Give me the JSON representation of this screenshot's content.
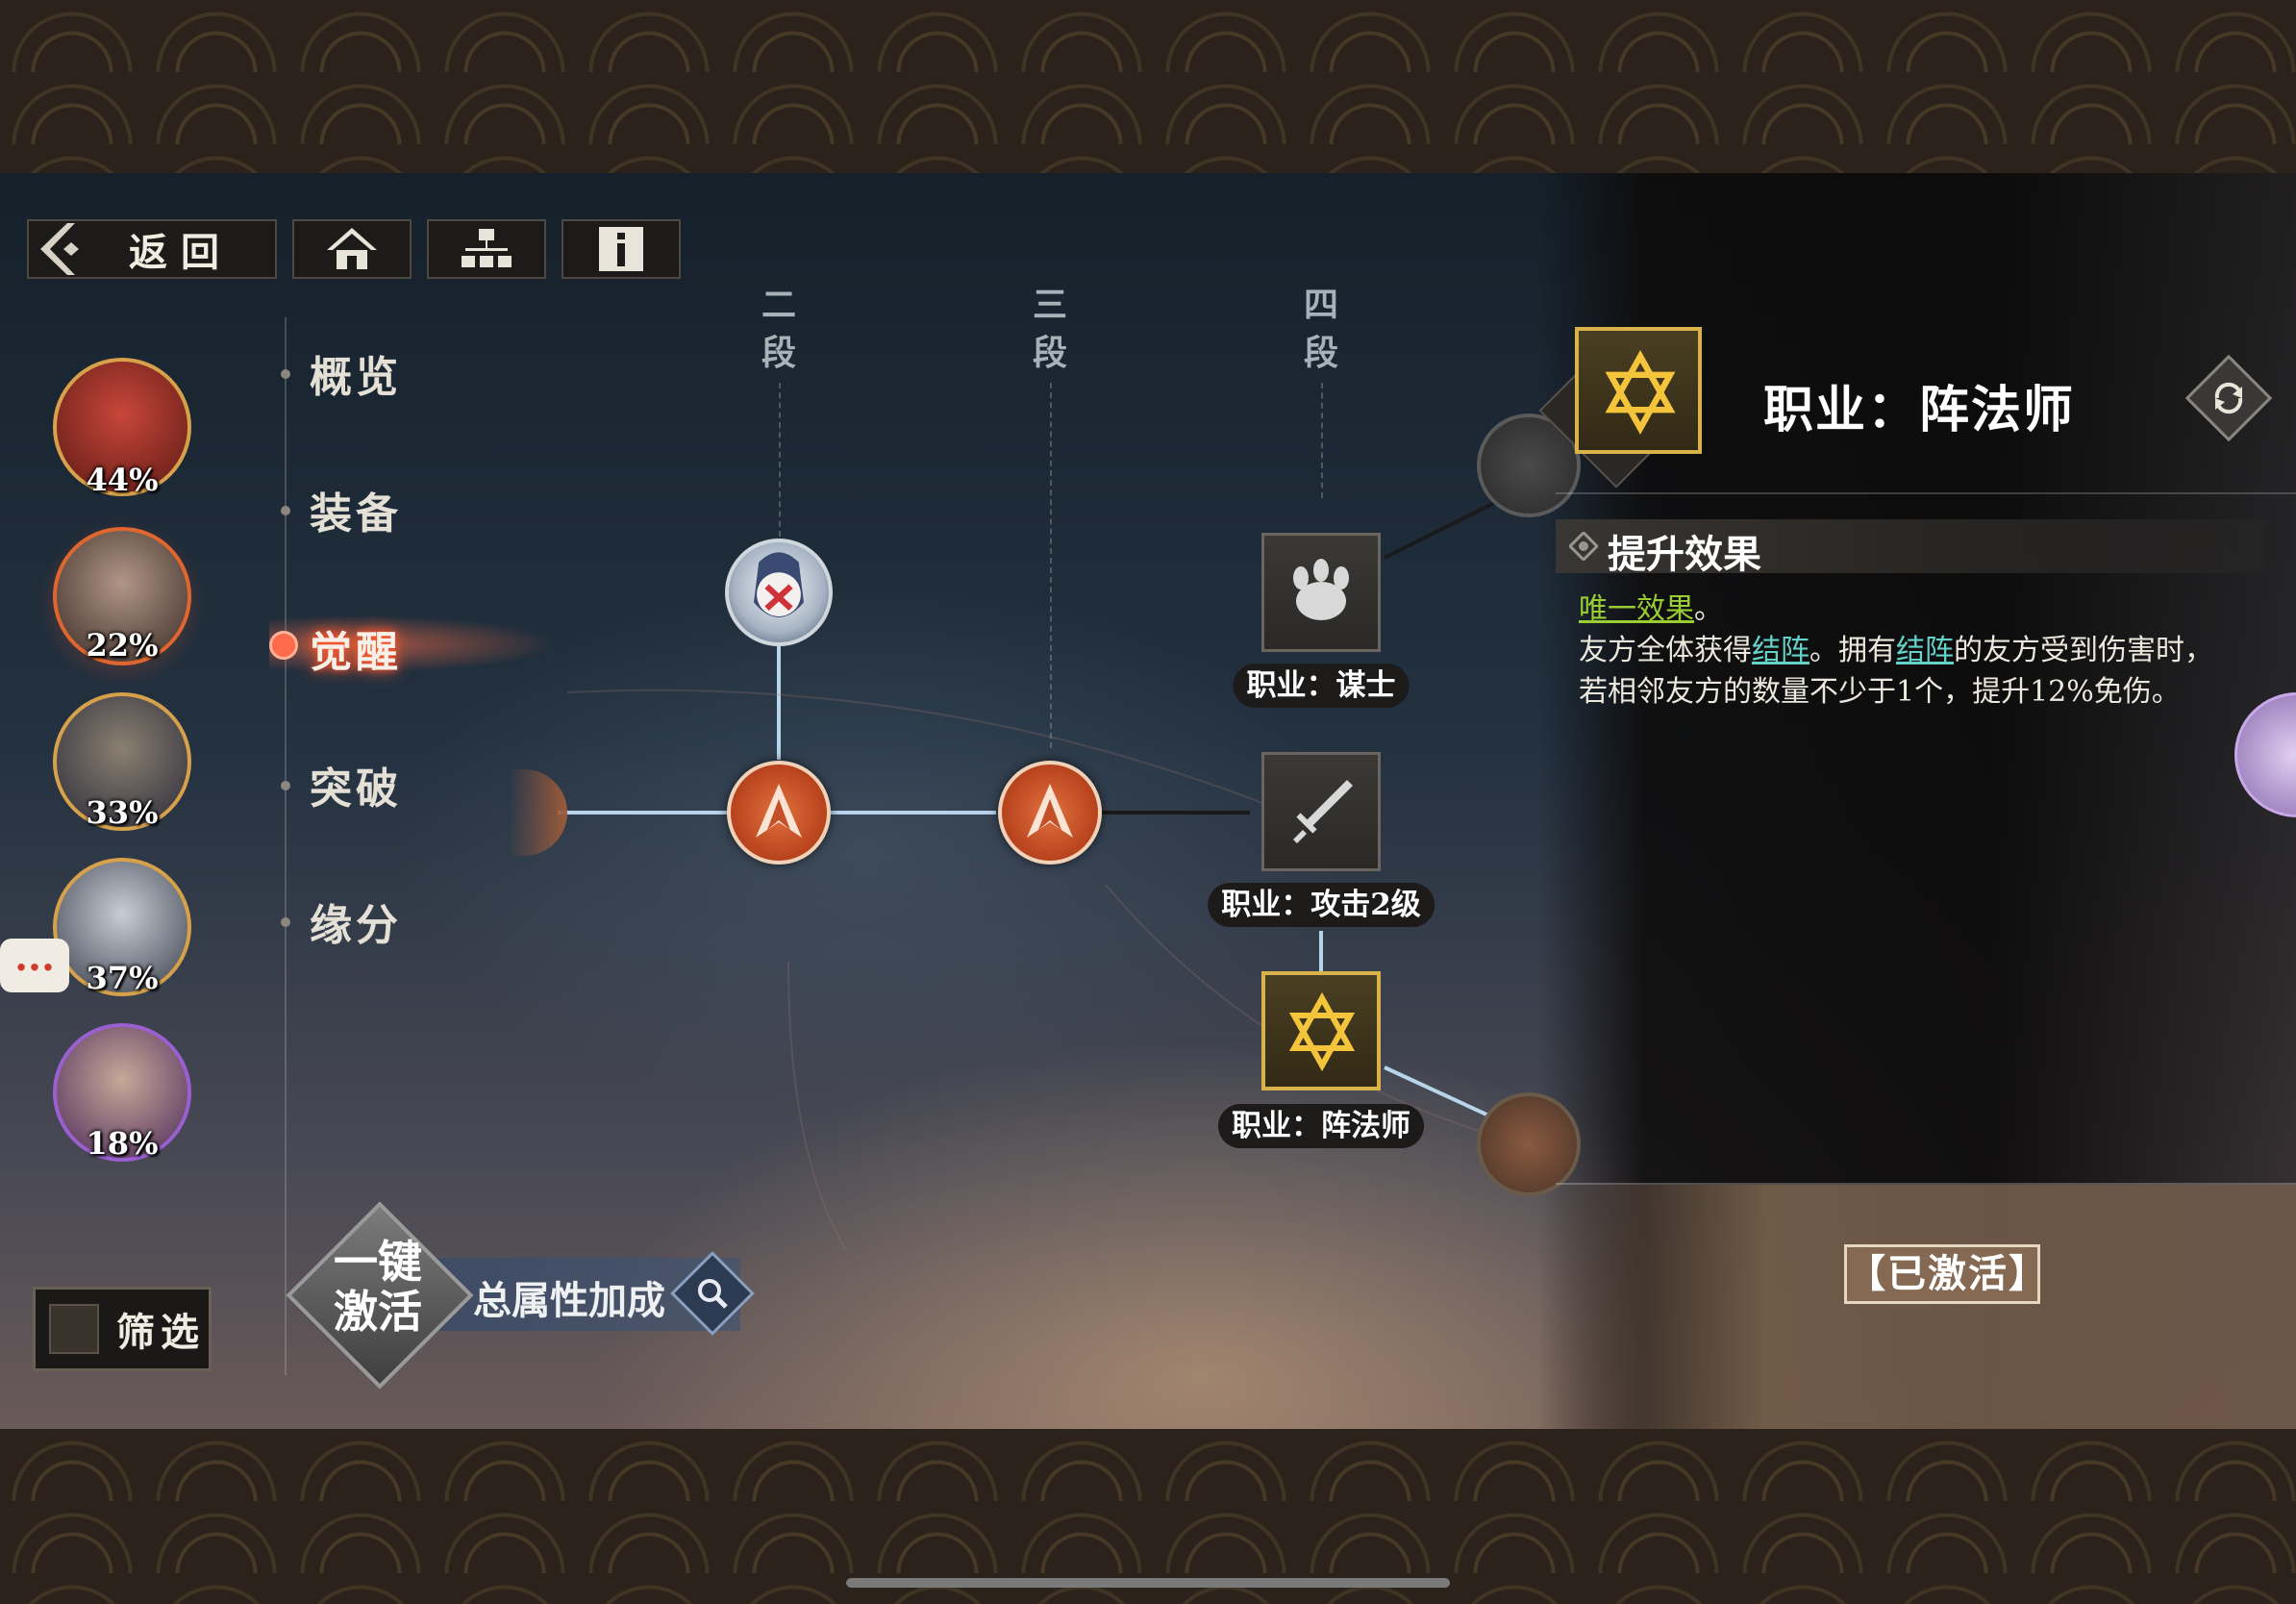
{
  "topbar": {
    "back_label": "返回",
    "buttons": [
      "home-icon",
      "tree-icon",
      "info-icon"
    ]
  },
  "heroes": [
    {
      "percent": "44%",
      "border": "#d6a14a",
      "face": "#b7372a"
    },
    {
      "percent": "22%",
      "border": "#e0662f",
      "face": "#5a463c"
    },
    {
      "percent": "33%",
      "border": "#d6a14a",
      "face": "#3a3a52"
    },
    {
      "percent": "37%",
      "border": "#d6a14a",
      "face": "#566070"
    },
    {
      "percent": "18%",
      "border": "#9a5fd0",
      "face": "#5a3a6a"
    }
  ],
  "chat_icon": "...",
  "nav": {
    "items": [
      "概览",
      "装备",
      "觉醒",
      "突破",
      "缘分"
    ],
    "active": "觉醒"
  },
  "tree": {
    "columns": [
      "二\n段",
      "三\n段",
      "四\n段"
    ],
    "labels": {
      "strategist": "职业：谋士",
      "attack": "职业：攻击2级",
      "mage": "职业：阵法师"
    }
  },
  "detail": {
    "title": "职业：阵法师",
    "section": "提升效果",
    "unique": "唯一效果",
    "unique_tail": "。",
    "line_a": "友方全体获得",
    "link1": "结阵",
    "line_b": "。拥有",
    "link2": "结阵",
    "line_c": "的友方受到伤害时，若相邻友方的数量不少于1个，提升12%免伤。",
    "status": "【已激活】"
  },
  "bottom": {
    "filter_label": "筛选",
    "activate_label": "一键激活",
    "bonus_label": "总属性加成"
  }
}
